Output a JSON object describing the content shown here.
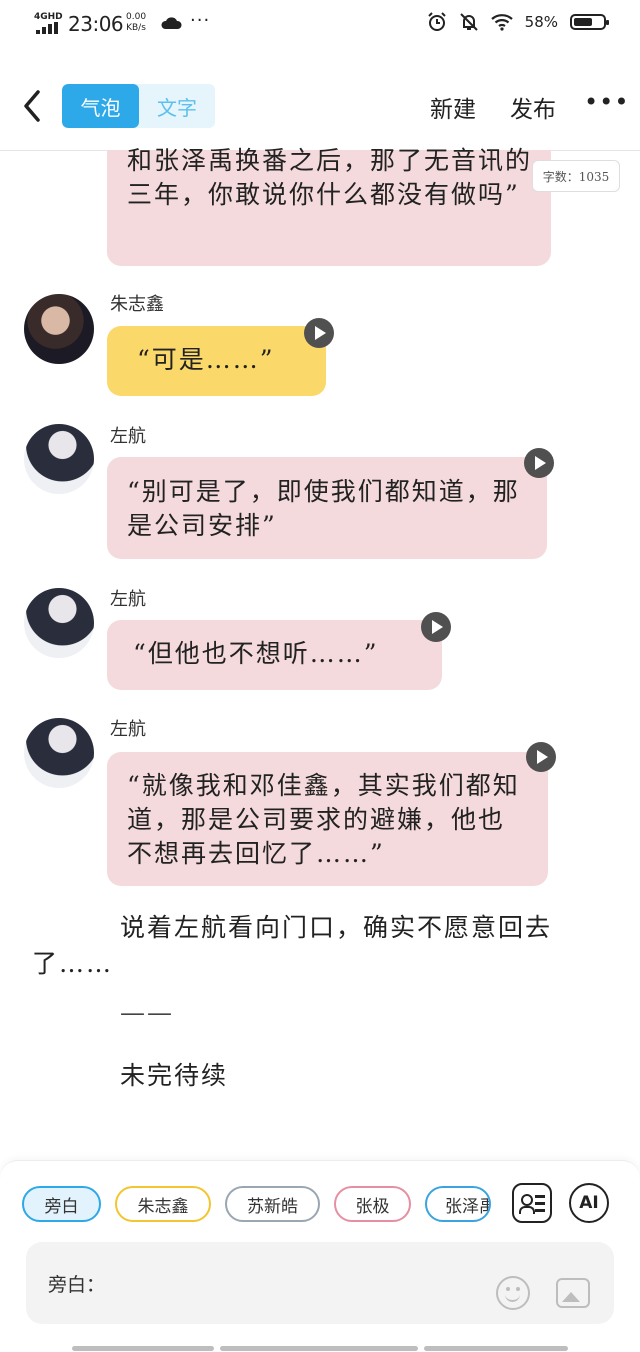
{
  "status_bar": {
    "signal": "4GHD",
    "time": "23:06",
    "net_speed_value": "0.00",
    "net_speed_unit": "KB/s",
    "battery": "58%"
  },
  "nav": {
    "tab_bubble": "气泡",
    "tab_text": "文字",
    "new_label": "新建",
    "publish_label": "发布",
    "more_label": "•••"
  },
  "word_count": "字数：1035",
  "messages": [
    {
      "speaker": "",
      "text": "和张泽禹换番之后，那了无音讯的三年，你敢说你什么都没有做吗”"
    },
    {
      "speaker": "朱志鑫",
      "text": "“可是……”"
    },
    {
      "speaker": "左航",
      "text": "“别可是了，即使我们都知道，那是公司安排”"
    },
    {
      "speaker": "左航",
      "text": "“但他也不想听……”"
    },
    {
      "speaker": "左航",
      "text": "“就像我和邓佳鑫，其实我们都知道，那是公司要求的避嫌，他也不想再去回忆了……”"
    }
  ],
  "narration": [
    {
      "line1": "说着左航看向门口，确实不愿意回去",
      "line2": "了……"
    },
    {
      "text": "——"
    },
    {
      "text": "未完待续"
    }
  ],
  "characters": [
    "旁白",
    "朱志鑫",
    "苏新皓",
    "张极",
    "张泽禹"
  ],
  "ai_label": "AI",
  "input_label": "旁白：",
  "colors": {
    "accent": "#2da8e8",
    "pink_bubble": "#f4dadc",
    "yellow_bubble": "#fbd86a"
  }
}
